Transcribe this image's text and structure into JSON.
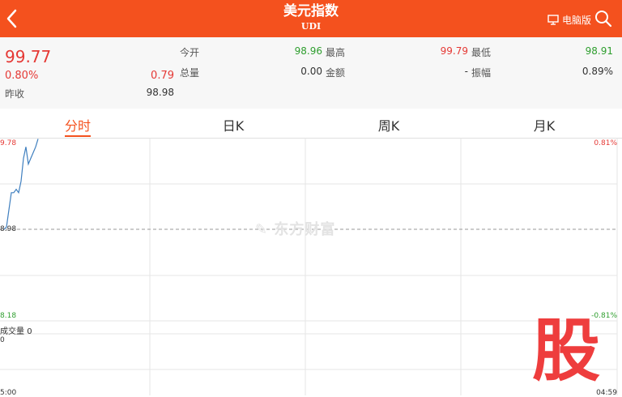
{
  "header": {
    "title": "美元指数",
    "subtitle": "UDI",
    "pc_version_label": "电脑版"
  },
  "quote": {
    "price": "99.77",
    "change_pct": "0.80%",
    "change": "0.79",
    "prev_close_label": "昨收",
    "prev_close": "98.98",
    "open_label": "今开",
    "open": "98.96",
    "high_label": "最高",
    "high": "99.79",
    "low_label": "最低",
    "low": "98.91",
    "volume_label": "总量",
    "volume": "0.00",
    "amount_label": "金额",
    "amount": "-",
    "amplitude_label": "振幅",
    "amplitude": "0.89%"
  },
  "tabs": [
    {
      "label": "分时",
      "active": true
    },
    {
      "label": "日K",
      "active": false
    },
    {
      "label": "周K",
      "active": false
    },
    {
      "label": "月K",
      "active": false
    }
  ],
  "chart_data": {
    "type": "line",
    "y_labels_left": [
      "9.78",
      "8.98",
      "8.18"
    ],
    "y_labels_right": [
      "0.81%",
      "-0.81%"
    ],
    "series": [
      {
        "values": [
          98.98,
          99.0,
          99.15,
          99.3,
          99.3,
          99.33,
          99.3,
          99.4,
          99.6,
          99.7,
          99.55,
          99.6,
          99.65,
          99.7,
          99.77
        ]
      }
    ],
    "volume_label": "成交量",
    "volume_value": "0",
    "volume_axis_value": "0",
    "x_label_left": "5:00",
    "x_label_right": "04:59",
    "watermark": "东方财富"
  },
  "colors": {
    "brand": "#f4511e",
    "up": "#e53935",
    "down": "#2e9e2e",
    "line": "#3f7fbf"
  },
  "badge": "股"
}
